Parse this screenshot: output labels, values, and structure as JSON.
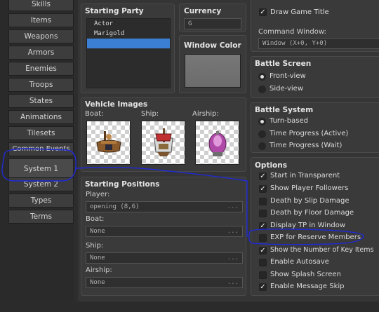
{
  "nav": {
    "items": [
      {
        "label": "Skills"
      },
      {
        "label": "Items"
      },
      {
        "label": "Weapons"
      },
      {
        "label": "Armors"
      },
      {
        "label": "Enemies"
      },
      {
        "label": "Troops"
      },
      {
        "label": "States"
      },
      {
        "label": "Animations"
      },
      {
        "label": "Tilesets"
      },
      {
        "label": "Common Events"
      },
      {
        "label": "System 1"
      },
      {
        "label": "System 2"
      },
      {
        "label": "Types"
      },
      {
        "label": "Terms"
      }
    ],
    "selected": "System 1"
  },
  "starting_party": {
    "title": "Starting Party",
    "members": [
      "Actor",
      "Marigold"
    ]
  },
  "currency": {
    "title": "Currency",
    "value": "G"
  },
  "window_color": {
    "title": "Window Color"
  },
  "draw_game_title": {
    "label": "Draw Game Title",
    "checked": true
  },
  "command_window": {
    "label": "Command Window:",
    "value": "Window (X+0, Y+0)"
  },
  "battle_screen": {
    "title": "Battle Screen",
    "options": [
      {
        "label": "Front-view",
        "selected": true
      },
      {
        "label": "Side-view",
        "selected": false
      }
    ]
  },
  "vehicle_images": {
    "title": "Vehicle Images",
    "labels": [
      "Boat:",
      "Ship:",
      "Airship:"
    ]
  },
  "battle_system": {
    "title": "Battle System",
    "options": [
      {
        "label": "Turn-based",
        "selected": true
      },
      {
        "label": "Time Progress (Active)",
        "selected": false
      },
      {
        "label": "Time Progress (Wait)",
        "selected": false
      }
    ]
  },
  "starting_positions": {
    "title": "Starting Positions",
    "fields": [
      {
        "label": "Player:",
        "value": "opening (8,6)"
      },
      {
        "label": "Boat:",
        "value": "None"
      },
      {
        "label": "Ship:",
        "value": "None"
      },
      {
        "label": "Airship:",
        "value": "None"
      }
    ],
    "more": "..."
  },
  "options": {
    "title": "Options",
    "items": [
      {
        "label": "Start in Transparent",
        "checked": true
      },
      {
        "label": "Show Player Followers",
        "checked": true
      },
      {
        "label": "Death by Slip Damage",
        "checked": false
      },
      {
        "label": "Death by Floor Damage",
        "checked": false
      },
      {
        "label": "Display TP in Window",
        "checked": true
      },
      {
        "label": "EXP for Reserve Members",
        "checked": false
      },
      {
        "label": "Show the Number of Key Items",
        "checked": true
      },
      {
        "label": "Enable Autosave",
        "checked": false
      },
      {
        "label": "Show Splash Screen",
        "checked": false
      },
      {
        "label": "Enable Message Skip",
        "checked": true
      }
    ]
  },
  "check_glyph": "✓",
  "colors": {
    "annotation": "#1f2ad6",
    "selection": "#3b7fd4"
  }
}
